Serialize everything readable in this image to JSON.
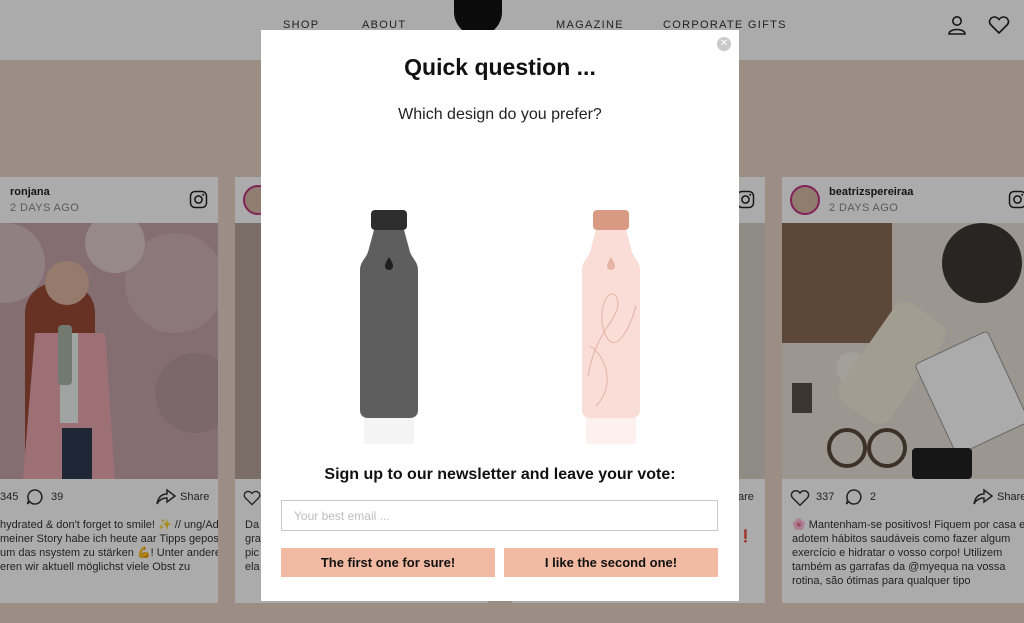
{
  "nav": {
    "items": [
      "SHOP",
      "ABOUT",
      "MAGAZINE",
      "CORPORATE GIFTS"
    ],
    "icons": [
      "user-icon",
      "heart-icon"
    ]
  },
  "cards": [
    {
      "username": "ronjana",
      "date": "2 DAYS AGO",
      "likes": "345",
      "comments": "39",
      "share": "Share",
      "caption": "hydrated & don't forget to smile! ✨ // ung/Ad . In meiner Story habe ich heute aar Tipps gepostet, um das nsystem zu stärken 💪! Unter anderem eren wir aktuell möglichst viele Obst zu"
    },
    {
      "caption": "Da gra pic ela"
    },
    {
      "share": "are"
    },
    {
      "username": "beatrizspereiraa",
      "date": "2 DAYS AGO",
      "likes": "337",
      "comments": "2",
      "share": "Share",
      "caption": "🌸 Mantenham-se positivos! Fiquem por casa e adotem hábitos saudáveis como fazer algum exercício e hidratar o vosso corpo! Utilizem também as garrafas da @myequa na vossa rotina, são ótimas para qualquer tipo"
    }
  ],
  "modal": {
    "close": "✕",
    "title": "Quick question ...",
    "subtitle": "Which design do you prefer?",
    "newsletter": "Sign up to our newsletter and leave your vote:",
    "email_placeholder": "Your best email ...",
    "email_value": "",
    "button_first": "The first one for sure!",
    "button_second": "I like the second one!",
    "bottles": [
      "dark-grey-bottle",
      "pink-bottle"
    ]
  },
  "colors": {
    "background": "#e9d2c7",
    "button": "#f2baa3",
    "overlay": "rgba(0,0,0,0.33)"
  }
}
